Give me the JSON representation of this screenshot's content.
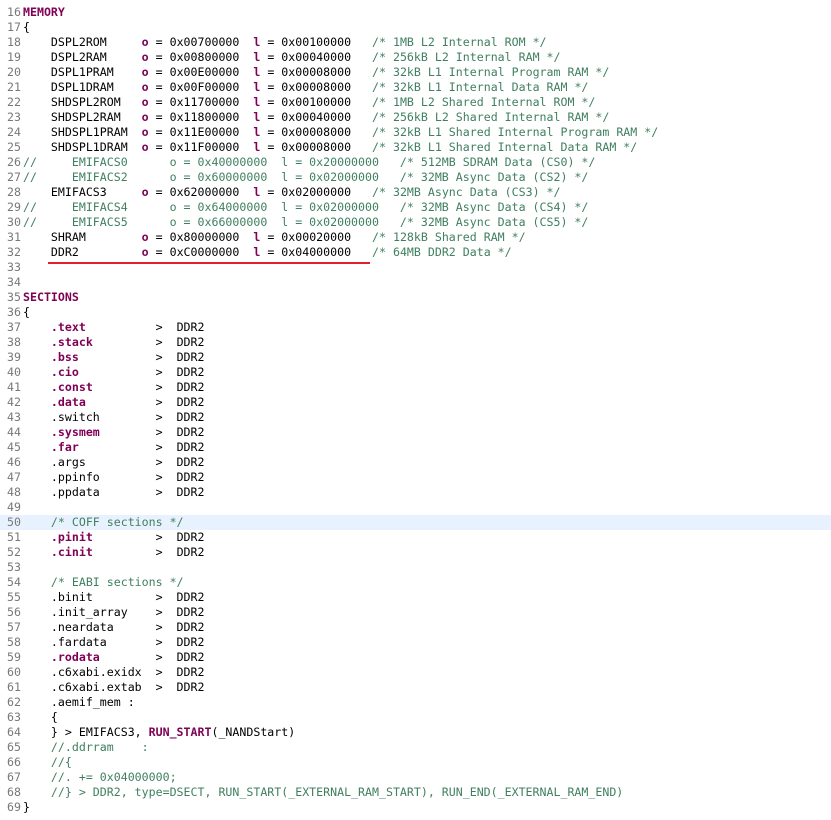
{
  "editor": {
    "lines": [
      {
        "n": "16",
        "segs": [
          {
            "t": "MEMORY",
            "c": "kw"
          }
        ]
      },
      {
        "n": "17",
        "segs": [
          {
            "t": "{",
            "c": "pl"
          }
        ]
      },
      {
        "n": "18",
        "segs": [
          {
            "t": "    DSPL2ROM     ",
            "c": "pl"
          },
          {
            "t": "o",
            "c": "op"
          },
          {
            "t": " = 0x00700000  ",
            "c": "pl"
          },
          {
            "t": "l",
            "c": "op"
          },
          {
            "t": " = 0x00100000   ",
            "c": "pl"
          },
          {
            "t": "/* 1MB L2 Internal ROM */",
            "c": "cm"
          }
        ]
      },
      {
        "n": "19",
        "segs": [
          {
            "t": "    DSPL2RAM     ",
            "c": "pl"
          },
          {
            "t": "o",
            "c": "op"
          },
          {
            "t": " = 0x00800000  ",
            "c": "pl"
          },
          {
            "t": "l",
            "c": "op"
          },
          {
            "t": " = 0x00040000   ",
            "c": "pl"
          },
          {
            "t": "/* 256kB L2 Internal RAM */",
            "c": "cm"
          }
        ]
      },
      {
        "n": "20",
        "segs": [
          {
            "t": "    DSPL1PRAM    ",
            "c": "pl"
          },
          {
            "t": "o",
            "c": "op"
          },
          {
            "t": " = 0x00E00000  ",
            "c": "pl"
          },
          {
            "t": "l",
            "c": "op"
          },
          {
            "t": " = 0x00008000   ",
            "c": "pl"
          },
          {
            "t": "/* 32kB L1 Internal Program RAM */",
            "c": "cm"
          }
        ]
      },
      {
        "n": "21",
        "segs": [
          {
            "t": "    DSPL1DRAM    ",
            "c": "pl"
          },
          {
            "t": "o",
            "c": "op"
          },
          {
            "t": " = 0x00F00000  ",
            "c": "pl"
          },
          {
            "t": "l",
            "c": "op"
          },
          {
            "t": " = 0x00008000   ",
            "c": "pl"
          },
          {
            "t": "/* 32kB L1 Internal Data RAM */",
            "c": "cm"
          }
        ]
      },
      {
        "n": "22",
        "segs": [
          {
            "t": "    SHDSPL2ROM   ",
            "c": "pl"
          },
          {
            "t": "o",
            "c": "op"
          },
          {
            "t": " = 0x11700000  ",
            "c": "pl"
          },
          {
            "t": "l",
            "c": "op"
          },
          {
            "t": " = 0x00100000   ",
            "c": "pl"
          },
          {
            "t": "/* 1MB L2 Shared Internal ROM */",
            "c": "cm"
          }
        ]
      },
      {
        "n": "23",
        "segs": [
          {
            "t": "    SHDSPL2RAM   ",
            "c": "pl"
          },
          {
            "t": "o",
            "c": "op"
          },
          {
            "t": " = 0x11800000  ",
            "c": "pl"
          },
          {
            "t": "l",
            "c": "op"
          },
          {
            "t": " = 0x00040000   ",
            "c": "pl"
          },
          {
            "t": "/* 256kB L2 Shared Internal RAM */",
            "c": "cm"
          }
        ]
      },
      {
        "n": "24",
        "segs": [
          {
            "t": "    SHDSPL1PRAM  ",
            "c": "pl"
          },
          {
            "t": "o",
            "c": "op"
          },
          {
            "t": " = 0x11E00000  ",
            "c": "pl"
          },
          {
            "t": "l",
            "c": "op"
          },
          {
            "t": " = 0x00008000   ",
            "c": "pl"
          },
          {
            "t": "/* 32kB L1 Shared Internal Program RAM */",
            "c": "cm"
          }
        ]
      },
      {
        "n": "25",
        "segs": [
          {
            "t": "    SHDSPL1DRAM  ",
            "c": "pl"
          },
          {
            "t": "o",
            "c": "op"
          },
          {
            "t": " = 0x11F00000  ",
            "c": "pl"
          },
          {
            "t": "l",
            "c": "op"
          },
          {
            "t": " = 0x00008000   ",
            "c": "pl"
          },
          {
            "t": "/* 32kB L1 Shared Internal Data RAM */",
            "c": "cm"
          }
        ]
      },
      {
        "n": "26",
        "segs": [
          {
            "t": "//     EMIFACS0      o = 0x40000000  l = 0x20000000   /* 512MB SDRAM Data (CS0) */",
            "c": "cm"
          }
        ]
      },
      {
        "n": "27",
        "segs": [
          {
            "t": "//     EMIFACS2      o = 0x60000000  l = 0x02000000   /* 32MB Async Data (CS2) */",
            "c": "cm"
          }
        ]
      },
      {
        "n": "28",
        "segs": [
          {
            "t": "    EMIFACS3     ",
            "c": "pl"
          },
          {
            "t": "o",
            "c": "op"
          },
          {
            "t": " = 0x62000000  ",
            "c": "pl"
          },
          {
            "t": "l",
            "c": "op"
          },
          {
            "t": " = 0x02000000   ",
            "c": "pl"
          },
          {
            "t": "/* 32MB Async Data (CS3) */",
            "c": "cm"
          }
        ]
      },
      {
        "n": "29",
        "segs": [
          {
            "t": "//     EMIFACS4      o = 0x64000000  l = 0x02000000   /* 32MB Async Data (CS4) */",
            "c": "cm"
          }
        ]
      },
      {
        "n": "30",
        "segs": [
          {
            "t": "//     EMIFACS5      o = 0x66000000  l = 0x02000000   /* 32MB Async Data (CS5) */",
            "c": "cm"
          }
        ]
      },
      {
        "n": "31",
        "segs": [
          {
            "t": "    SHRAM        ",
            "c": "pl"
          },
          {
            "t": "o",
            "c": "op"
          },
          {
            "t": " = 0x80000000  ",
            "c": "pl"
          },
          {
            "t": "l",
            "c": "op"
          },
          {
            "t": " = 0x00020000   ",
            "c": "pl"
          },
          {
            "t": "/* 128kB Shared RAM */",
            "c": "cm"
          }
        ]
      },
      {
        "n": "32",
        "segs": [
          {
            "t": "    DDR2         ",
            "c": "pl"
          },
          {
            "t": "o",
            "c": "op"
          },
          {
            "t": " = 0xC0000000  ",
            "c": "pl"
          },
          {
            "t": "l",
            "c": "op"
          },
          {
            "t": " = 0x04000000   ",
            "c": "pl"
          },
          {
            "t": "/* 64MB DDR2 Data */",
            "c": "cm"
          }
        ]
      },
      {
        "n": "33",
        "segs": []
      },
      {
        "n": "34",
        "segs": []
      },
      {
        "n": "35",
        "segs": [
          {
            "t": "SECTIONS",
            "c": "kw"
          }
        ]
      },
      {
        "n": "36",
        "segs": [
          {
            "t": "{",
            "c": "pl"
          }
        ]
      },
      {
        "n": "37",
        "segs": [
          {
            "t": "    ",
            "c": "pl"
          },
          {
            "t": ".text",
            "c": "sec"
          },
          {
            "t": "          >  DDR2",
            "c": "pl"
          }
        ]
      },
      {
        "n": "38",
        "segs": [
          {
            "t": "    ",
            "c": "pl"
          },
          {
            "t": ".stack",
            "c": "sec"
          },
          {
            "t": "         >  DDR2",
            "c": "pl"
          }
        ]
      },
      {
        "n": "39",
        "segs": [
          {
            "t": "    ",
            "c": "pl"
          },
          {
            "t": ".bss",
            "c": "sec"
          },
          {
            "t": "           >  DDR2",
            "c": "pl"
          }
        ]
      },
      {
        "n": "40",
        "segs": [
          {
            "t": "    ",
            "c": "pl"
          },
          {
            "t": ".cio",
            "c": "sec"
          },
          {
            "t": "           >  DDR2",
            "c": "pl"
          }
        ]
      },
      {
        "n": "41",
        "segs": [
          {
            "t": "    ",
            "c": "pl"
          },
          {
            "t": ".const",
            "c": "sec"
          },
          {
            "t": "         >  DDR2",
            "c": "pl"
          }
        ]
      },
      {
        "n": "42",
        "segs": [
          {
            "t": "    ",
            "c": "pl"
          },
          {
            "t": ".data",
            "c": "sec"
          },
          {
            "t": "          >  DDR2",
            "c": "pl"
          }
        ]
      },
      {
        "n": "43",
        "segs": [
          {
            "t": "    .switch        >  DDR2",
            "c": "pl"
          }
        ]
      },
      {
        "n": "44",
        "segs": [
          {
            "t": "    ",
            "c": "pl"
          },
          {
            "t": ".sysmem",
            "c": "sec"
          },
          {
            "t": "        >  DDR2",
            "c": "pl"
          }
        ]
      },
      {
        "n": "45",
        "segs": [
          {
            "t": "    ",
            "c": "pl"
          },
          {
            "t": ".far",
            "c": "sec"
          },
          {
            "t": "           >  DDR2",
            "c": "pl"
          }
        ]
      },
      {
        "n": "46",
        "segs": [
          {
            "t": "    .args          >  DDR2",
            "c": "pl"
          }
        ]
      },
      {
        "n": "47",
        "segs": [
          {
            "t": "    .ppinfo        >  DDR2",
            "c": "pl"
          }
        ]
      },
      {
        "n": "48",
        "segs": [
          {
            "t": "    .ppdata        >  DDR2",
            "c": "pl"
          }
        ]
      },
      {
        "n": "49",
        "segs": []
      },
      {
        "n": "50",
        "hl": true,
        "segs": [
          {
            "t": "    ",
            "c": "pl"
          },
          {
            "t": "/* COFF sections */",
            "c": "cm"
          }
        ]
      },
      {
        "n": "51",
        "segs": [
          {
            "t": "    ",
            "c": "pl"
          },
          {
            "t": ".pinit",
            "c": "sec"
          },
          {
            "t": "         >  DDR2",
            "c": "pl"
          }
        ]
      },
      {
        "n": "52",
        "segs": [
          {
            "t": "    ",
            "c": "pl"
          },
          {
            "t": ".cinit",
            "c": "sec"
          },
          {
            "t": "         >  DDR2",
            "c": "pl"
          }
        ]
      },
      {
        "n": "53",
        "segs": []
      },
      {
        "n": "54",
        "segs": [
          {
            "t": "    ",
            "c": "pl"
          },
          {
            "t": "/* EABI sections */",
            "c": "cm"
          }
        ]
      },
      {
        "n": "55",
        "segs": [
          {
            "t": "    .binit         >  DDR2",
            "c": "pl"
          }
        ]
      },
      {
        "n": "56",
        "segs": [
          {
            "t": "    .init_array    >  DDR2",
            "c": "pl"
          }
        ]
      },
      {
        "n": "57",
        "segs": [
          {
            "t": "    .neardata      >  DDR2",
            "c": "pl"
          }
        ]
      },
      {
        "n": "58",
        "segs": [
          {
            "t": "    .fardata       >  DDR2",
            "c": "pl"
          }
        ]
      },
      {
        "n": "59",
        "segs": [
          {
            "t": "    ",
            "c": "pl"
          },
          {
            "t": ".rodata",
            "c": "sec"
          },
          {
            "t": "        >  DDR2",
            "c": "pl"
          }
        ]
      },
      {
        "n": "60",
        "segs": [
          {
            "t": "    .c6xabi.exidx  >  DDR2",
            "c": "pl"
          }
        ]
      },
      {
        "n": "61",
        "segs": [
          {
            "t": "    .c6xabi.extab  >  DDR2",
            "c": "pl"
          }
        ]
      },
      {
        "n": "62",
        "segs": [
          {
            "t": "    .aemif_mem :",
            "c": "pl"
          }
        ]
      },
      {
        "n": "63",
        "segs": [
          {
            "t": "    {",
            "c": "pl"
          }
        ]
      },
      {
        "n": "64",
        "segs": [
          {
            "t": "    } > EMIFACS3, ",
            "c": "pl"
          },
          {
            "t": "RUN_START",
            "c": "kw"
          },
          {
            "t": "(_NANDStart)",
            "c": "pl"
          }
        ]
      },
      {
        "n": "65",
        "segs": [
          {
            "t": "    //.ddrram    :",
            "c": "cm"
          }
        ]
      },
      {
        "n": "66",
        "segs": [
          {
            "t": "    //{",
            "c": "cm"
          }
        ]
      },
      {
        "n": "67",
        "segs": [
          {
            "t": "    //. += 0x04000000;",
            "c": "cm"
          }
        ]
      },
      {
        "n": "68",
        "segs": [
          {
            "t": "    //} > DDR2, type=DSECT, RUN_START(_EXTERNAL_RAM_START), RUN_END(_EXTERNAL_RAM_END)",
            "c": "cm"
          }
        ]
      },
      {
        "n": "69",
        "segs": [
          {
            "t": "}",
            "c": "pl"
          }
        ]
      }
    ]
  }
}
